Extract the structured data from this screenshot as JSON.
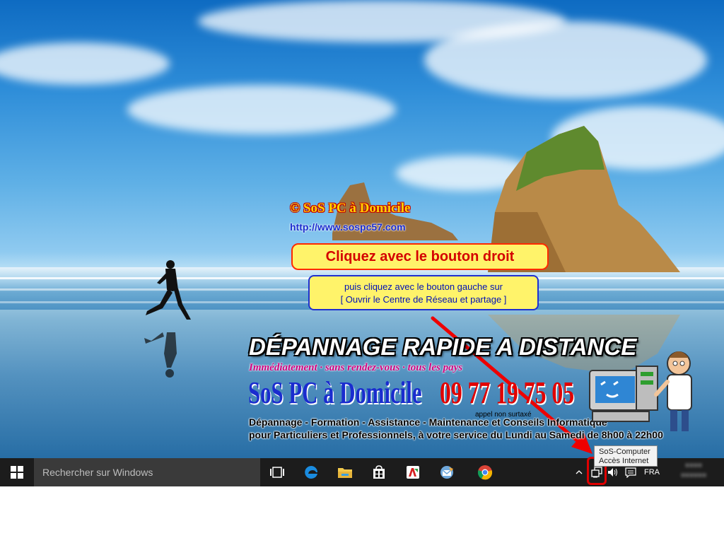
{
  "watermark": {
    "copyright": "© SoS PC à Domicile",
    "url": "http://www.sospc57.com"
  },
  "instructions": {
    "step1": "Cliquez avec le bouton droit",
    "step2_line1": "puis cliquez avec le bouton gauche sur",
    "step2_line2": "[ Ouvrir le Centre de Réseau et partage ]"
  },
  "banner": {
    "title": "DÉPANNAGE RAPIDE A DISTANCE",
    "subtitle": "Immédiatement · sans rendez-vous · tous les pays",
    "brand": "SoS PC à Domicile",
    "phone": "09 77 19 75 05",
    "call_note": "appel non surtaxé",
    "line1": "Dépannage - Formation - Assistance - Maintenance et Conseils Informatique",
    "line2": "pour Particuliers et Professionnels, à votre service du Lundi au Samedi de 8h00 à 22h00"
  },
  "taskbar": {
    "search_placeholder": "Rechercher sur Windows",
    "language": "FRA",
    "pinned": [
      {
        "name": "task-view-icon"
      },
      {
        "name": "edge-icon"
      },
      {
        "name": "file-explorer-icon"
      },
      {
        "name": "store-icon"
      },
      {
        "name": "red-app-icon"
      },
      {
        "name": "email-app-icon"
      },
      {
        "name": "chrome-icon"
      }
    ],
    "tray_icons": [
      "chevron-up-icon",
      "network-icon",
      "volume-icon",
      "notification-icon"
    ]
  },
  "tooltip": {
    "line1": "SoS-Computer",
    "line2": "Accès Internet"
  },
  "colors": {
    "taskbar_bg": "#1c1c1c",
    "search_bg": "#3a3a3a",
    "callout_fill": "#fff36a",
    "callout_red": "#d40000",
    "callout_blue": "#0010b8",
    "highlight_red": "#e00000",
    "brand_blue": "#1a2ccf"
  }
}
